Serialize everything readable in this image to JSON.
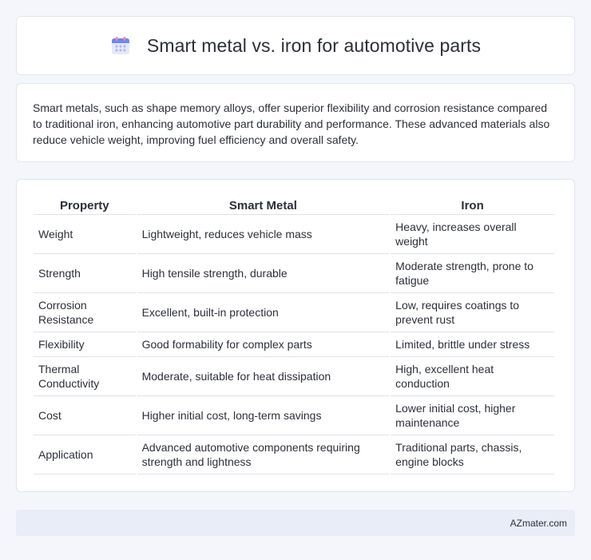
{
  "header": {
    "title": "Smart metal vs. iron for automotive parts",
    "icon": "calendar-icon"
  },
  "summary": {
    "text": "Smart metals, such as shape memory alloys, offer superior flexibility and corrosion resistance compared to traditional iron, enhancing automotive part durability and performance. These advanced materials also reduce vehicle weight, improving fuel efficiency and overall safety."
  },
  "table": {
    "headers": [
      "Property",
      "Smart Metal",
      "Iron"
    ],
    "rows": [
      [
        "Weight",
        "Lightweight, reduces vehicle mass",
        "Heavy, increases overall weight"
      ],
      [
        "Strength",
        "High tensile strength, durable",
        "Moderate strength, prone to fatigue"
      ],
      [
        "Corrosion Resistance",
        "Excellent, built-in protection",
        "Low, requires coatings to prevent rust"
      ],
      [
        "Flexibility",
        "Good formability for complex parts",
        "Limited, brittle under stress"
      ],
      [
        "Thermal Conductivity",
        "Moderate, suitable for heat dissipation",
        "High, excellent heat conduction"
      ],
      [
        "Cost",
        "Higher initial cost, long-term savings",
        "Lower initial cost, higher maintenance"
      ],
      [
        "Application",
        "Advanced automotive components requiring strength and lightness",
        "Traditional parts, chassis, engine blocks"
      ]
    ]
  },
  "footer": {
    "text": "AZmater.com"
  },
  "colors": {
    "background": "#f4f6fb",
    "card": "#ffffff",
    "footer": "#e9edf7",
    "icon_accent": "#7b8ff0"
  }
}
